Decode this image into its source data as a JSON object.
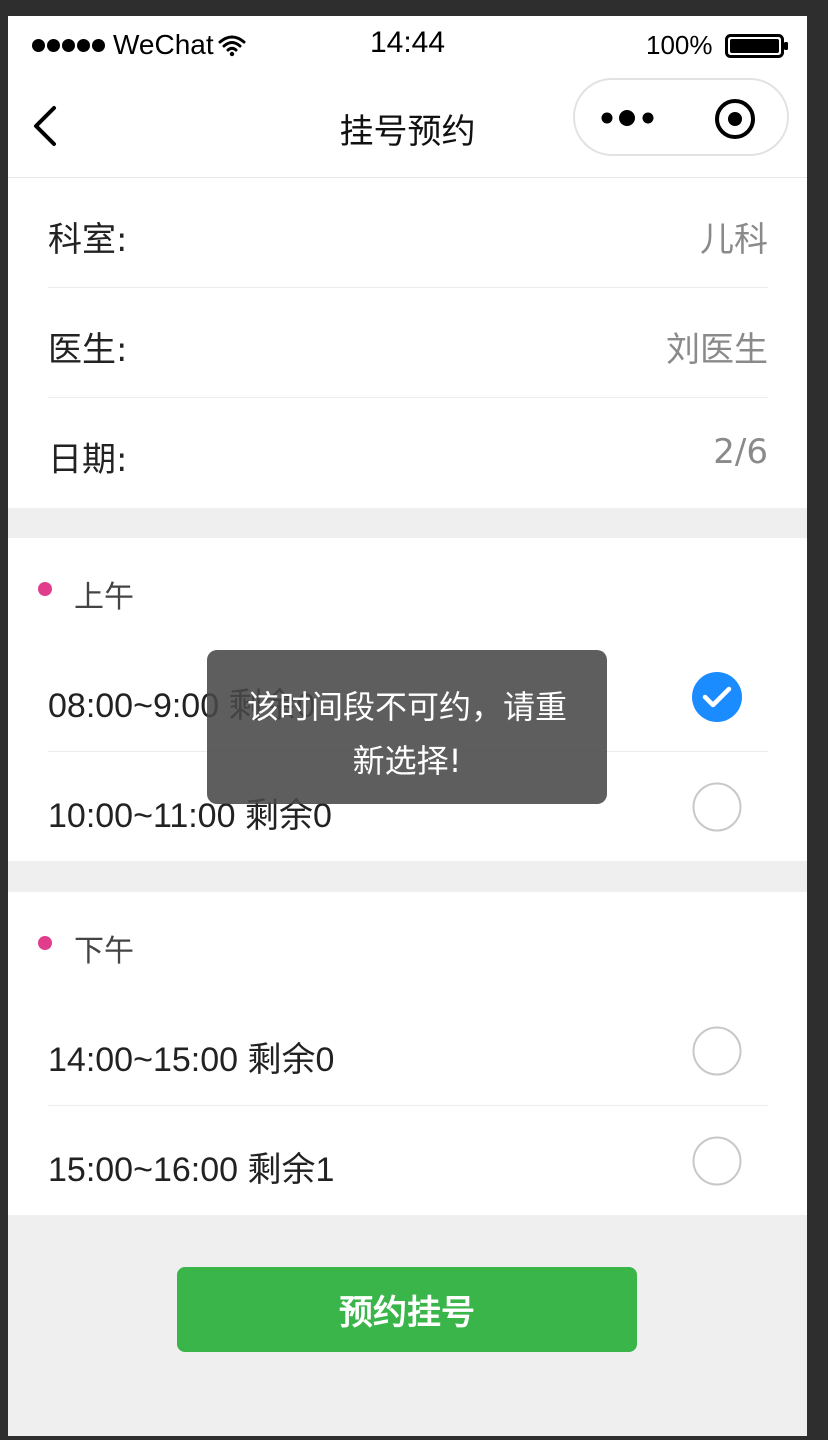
{
  "status_bar": {
    "carrier": "WeChat",
    "time": "14:44",
    "battery": "100%"
  },
  "nav": {
    "title": "挂号预约"
  },
  "info": {
    "department_label": "科室:",
    "department_value": "儿科",
    "doctor_label": "医生:",
    "doctor_value": "刘医生",
    "date_label": "日期:",
    "date_value": "2/6"
  },
  "morning": {
    "title": "上午",
    "slots": [
      {
        "text": "08:00~9:00 剩余0",
        "selected": true
      },
      {
        "text": "10:00~11:00 剩余0",
        "selected": false
      }
    ]
  },
  "afternoon": {
    "title": "下午",
    "slots": [
      {
        "text": "14:00~15:00 剩余0",
        "selected": false
      },
      {
        "text": "15:00~16:00 剩余1",
        "selected": false
      }
    ]
  },
  "submit_label": "预约挂号",
  "toast": {
    "message": "该时间段不可约，请重新选择!"
  },
  "colors": {
    "accent_green": "#39b54a",
    "selected_blue": "#1a8cff",
    "section_dot": "#e23c8d"
  },
  "icons": [
    "wifi-icon",
    "battery-icon",
    "back-icon",
    "more-icon",
    "capsule-close-icon",
    "checked-radio-icon",
    "radio-icon"
  ]
}
